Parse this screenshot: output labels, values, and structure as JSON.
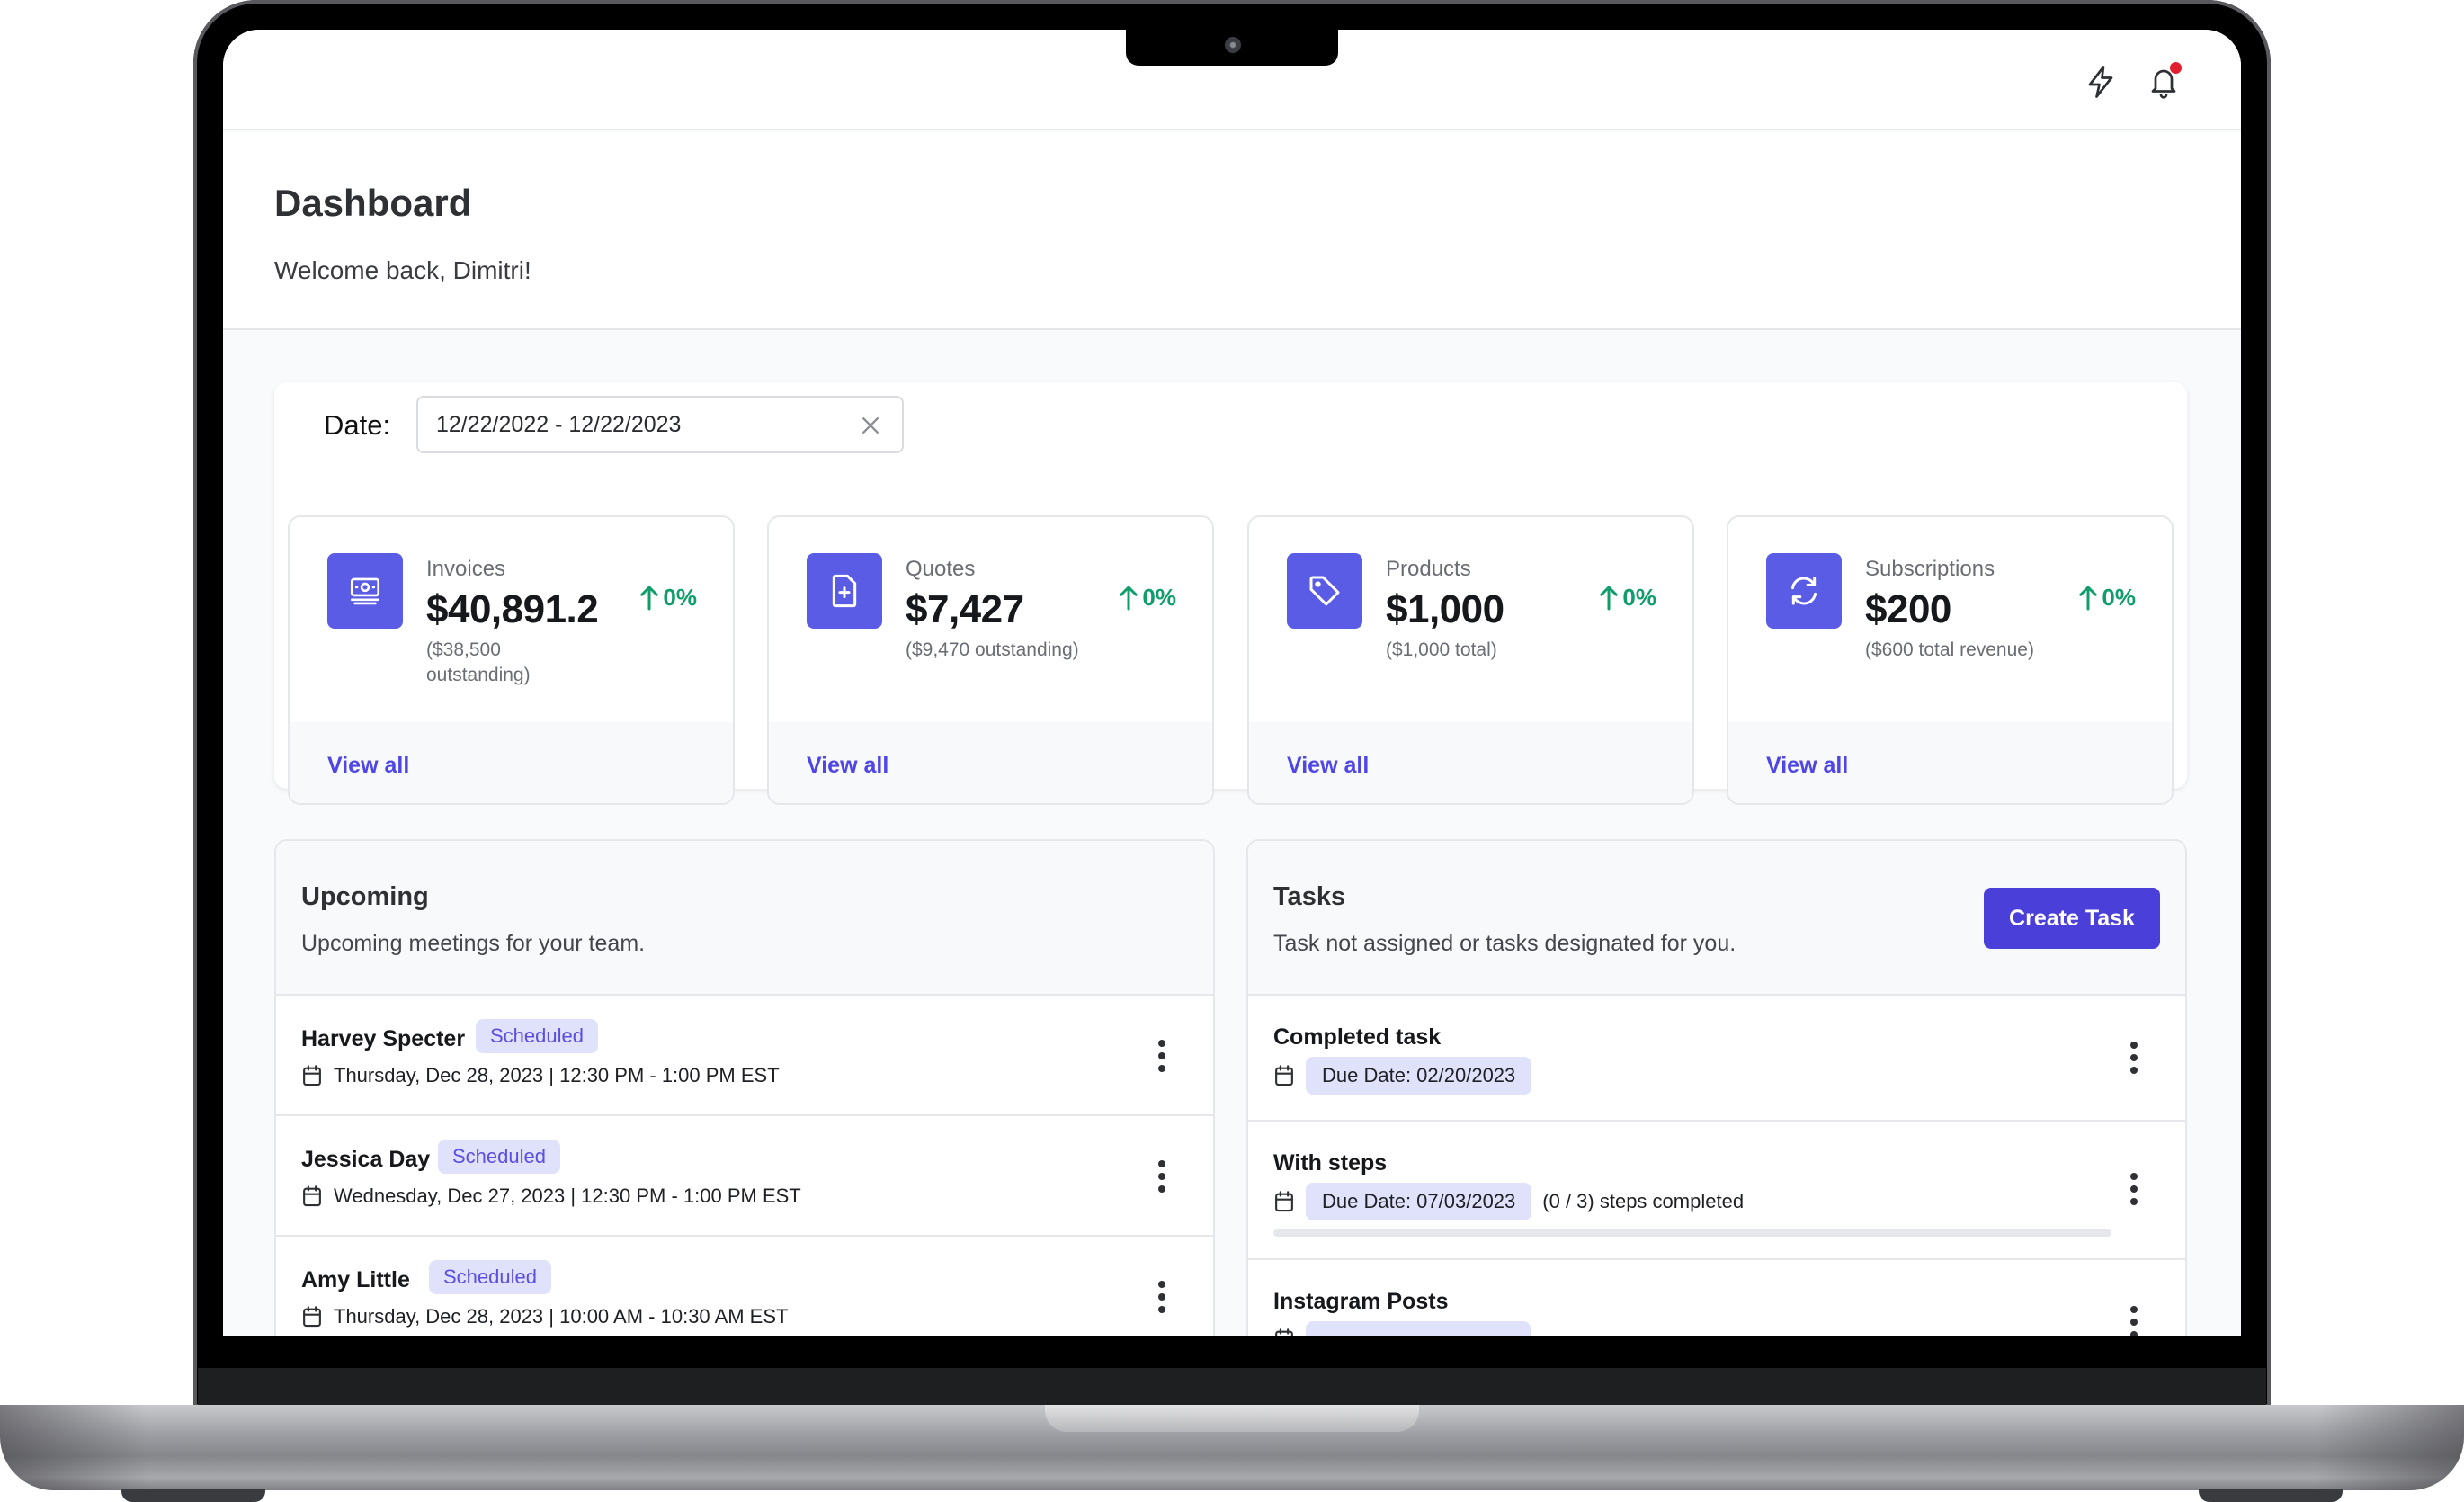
{
  "topbar": {
    "icons": [
      "lightning-icon",
      "bell-icon"
    ],
    "notification_dot_color": "#e11d2e"
  },
  "header": {
    "title": "Dashboard",
    "welcome": "Welcome back, Dimitri!"
  },
  "filters": {
    "date_label": "Date:",
    "date_range": "12/22/2022 - 12/22/2023"
  },
  "stats": [
    {
      "label": "Invoices",
      "value": "$40,891.2",
      "sub": "($38,500 outstanding)",
      "trend": "0%",
      "icon": "money-icon",
      "link": "View all"
    },
    {
      "label": "Quotes",
      "value": "$7,427",
      "sub": "($9,470 outstanding)",
      "trend": "0%",
      "icon": "document-plus-icon",
      "link": "View all"
    },
    {
      "label": "Products",
      "value": "$1,000",
      "sub": "($1,000 total)",
      "trend": "0%",
      "icon": "tag-icon",
      "link": "View all"
    },
    {
      "label": "Subscriptions",
      "value": "$200",
      "sub": "($600 total revenue)",
      "trend": "0%",
      "icon": "refresh-icon",
      "link": "View all"
    }
  ],
  "upcoming": {
    "title": "Upcoming",
    "description": "Upcoming meetings for your team.",
    "items": [
      {
        "name": "Harvey Specter",
        "status": "Scheduled",
        "when": "Thursday, Dec 28, 2023 | 12:30 PM - 1:00 PM EST"
      },
      {
        "name": "Jessica Day",
        "status": "Scheduled",
        "when": "Wednesday, Dec 27, 2023 | 12:30 PM - 1:00 PM EST"
      },
      {
        "name": "Amy Little",
        "status": "Scheduled",
        "when": "Thursday, Dec 28, 2023 | 10:00 AM - 10:30 AM EST"
      }
    ]
  },
  "tasks": {
    "title": "Tasks",
    "description": "Task not assigned or tasks designated for you.",
    "create_label": "Create Task",
    "items": [
      {
        "name": "Completed task",
        "due": "Due Date: 02/20/2023"
      },
      {
        "name": "With steps",
        "due": "Due Date: 07/03/2023",
        "steps": "(0 / 3) steps completed",
        "progress": 0
      },
      {
        "name": "Instagram Posts"
      }
    ]
  },
  "colors": {
    "accent": "#4f46e5",
    "icon_bg": "#5a5ce5",
    "trend_up": "#0f9d6a",
    "badge_bg": "#e0e1fb"
  }
}
